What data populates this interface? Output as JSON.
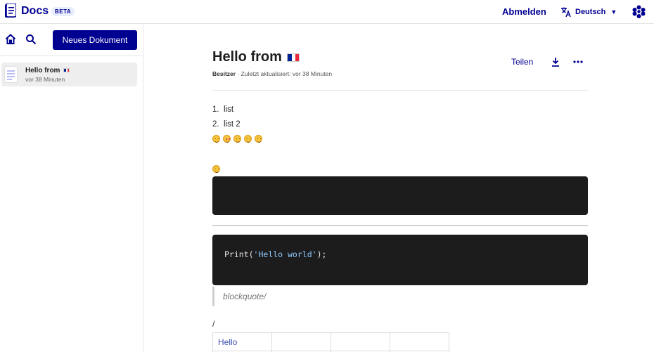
{
  "header": {
    "brand": "Docs",
    "badge": "BETA",
    "logout_label": "Abmelden",
    "language_label": "Deutsch",
    "icons": {
      "logo": "docs-logo-icon",
      "translate": "translate-icon",
      "caret": "caret-down-icon",
      "apps": "apps-grid-icon"
    }
  },
  "sidebar": {
    "new_document_label": "Neues Dokument",
    "icons": {
      "home": "home-icon",
      "search": "search-icon"
    },
    "documents": [
      {
        "title": "Hello from",
        "flag": "flag-fr",
        "updated": "vor 38 Minuten"
      }
    ]
  },
  "document": {
    "title": "Hello from",
    "title_flag": "flag-fr",
    "meta_role": "Besitzer",
    "meta_separator": " · ",
    "meta_updated": "Zuletzt aktualisiert: vor 38 Minuten",
    "share_label": "Teilen",
    "icons": {
      "download": "download-icon",
      "more": "more-dots-icon"
    },
    "list_items": [
      {
        "num": "1.",
        "text": "list"
      },
      {
        "num": "2.",
        "text": "list 2"
      }
    ],
    "emoji_row": [
      "grinning-face",
      "heart-eyes-face",
      "star-struck-face",
      "relieved-face",
      "smiling-face"
    ],
    "single_emoji": "smiling-face",
    "code": {
      "func": "Print(",
      "string": "'Hello world'",
      "end": ");"
    },
    "blockquote": "blockquote/",
    "slash_text": "/",
    "table_first_cell": "Hello"
  },
  "colors": {
    "accent": "#000091",
    "code_bg": "#1c1c1c",
    "link_text": "#3f51b5"
  }
}
